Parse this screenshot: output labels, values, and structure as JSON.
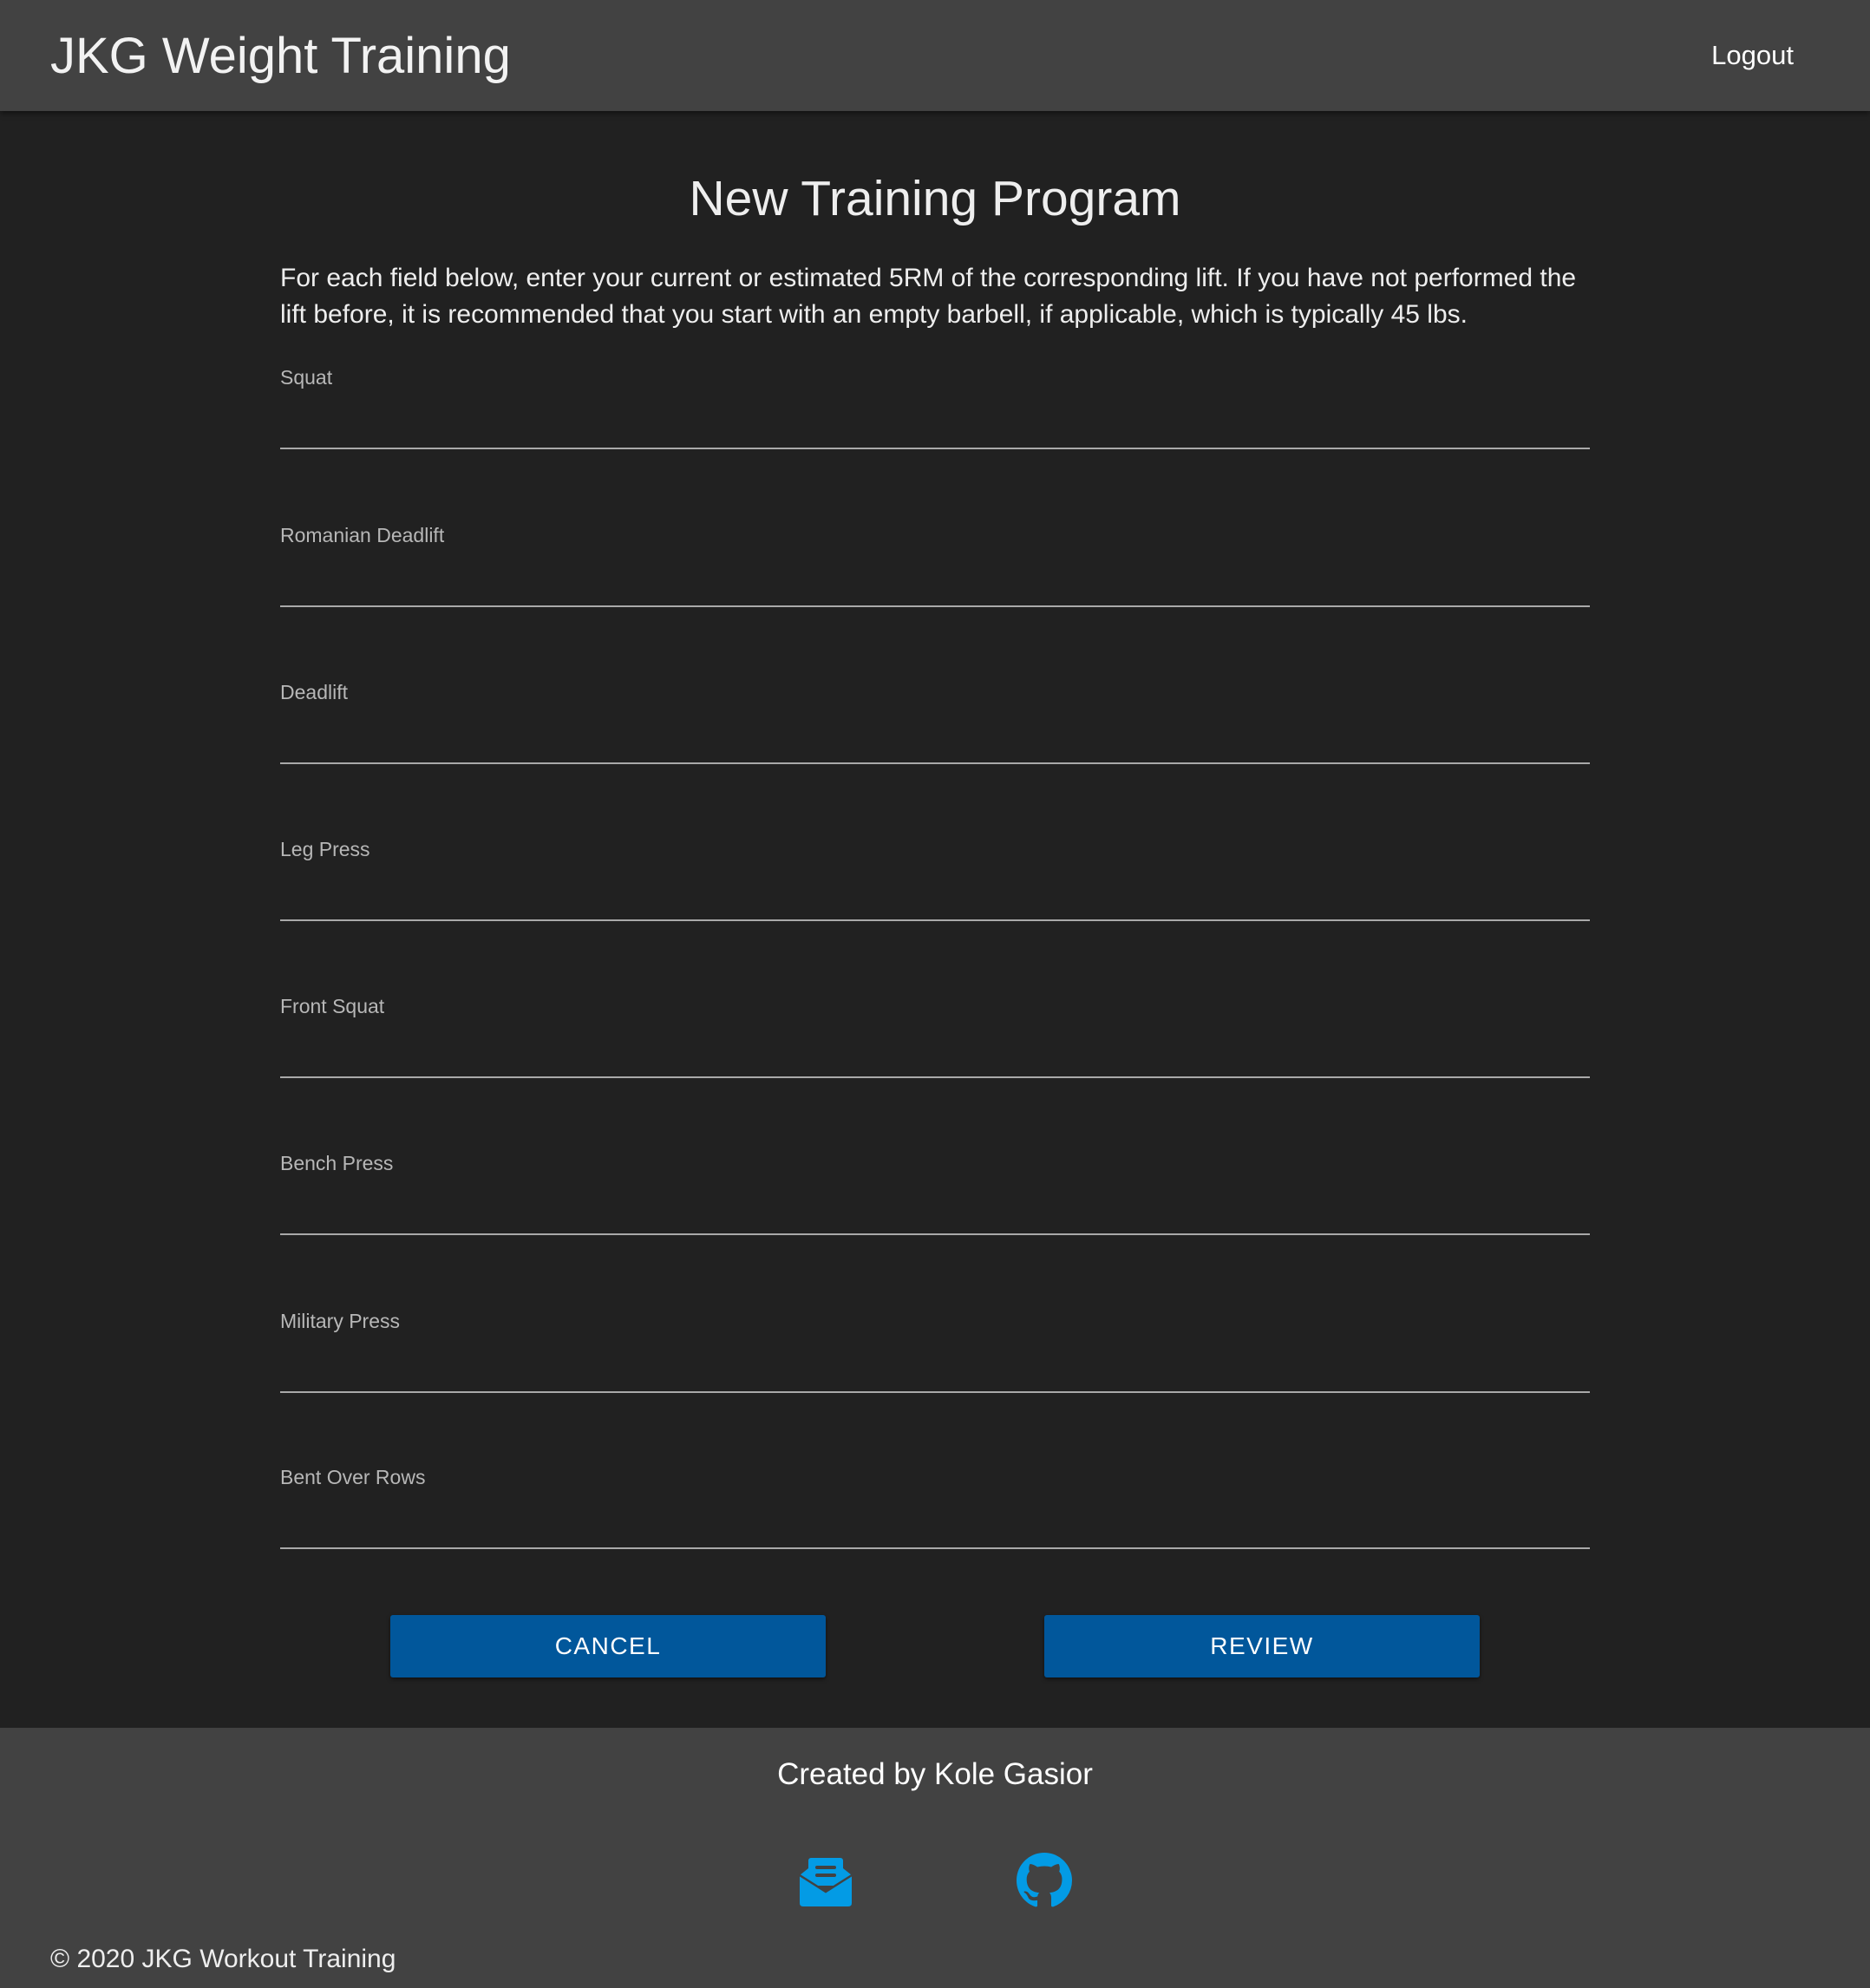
{
  "header": {
    "app_title": "JKG Weight Training",
    "logout_label": "Logout"
  },
  "main": {
    "page_title": "New Training Program",
    "intro": "For each field below, enter your current or estimated 5RM of the corresponding lift. If you have not performed the lift before, it is recommended that you start with an empty barbell, if applicable, which is typically 45 lbs.",
    "fields": [
      {
        "label": "Squat",
        "value": ""
      },
      {
        "label": "Romanian Deadlift",
        "value": ""
      },
      {
        "label": "Deadlift",
        "value": ""
      },
      {
        "label": "Leg Press",
        "value": ""
      },
      {
        "label": "Front Squat",
        "value": ""
      },
      {
        "label": "Bench Press",
        "value": ""
      },
      {
        "label": "Military Press",
        "value": ""
      },
      {
        "label": "Bent Over Rows",
        "value": ""
      }
    ],
    "buttons": {
      "cancel_label": "CANCEL",
      "review_label": "REVIEW"
    }
  },
  "footer": {
    "credit": "Created by Kole Gasior",
    "icons": [
      "email-icon",
      "github-icon"
    ],
    "copyright": "© 2020 JKG Workout Training"
  },
  "colors": {
    "header_bg": "#424242",
    "page_bg": "#212121",
    "button_bg": "#01579b",
    "icon_accent": "#039be5"
  }
}
